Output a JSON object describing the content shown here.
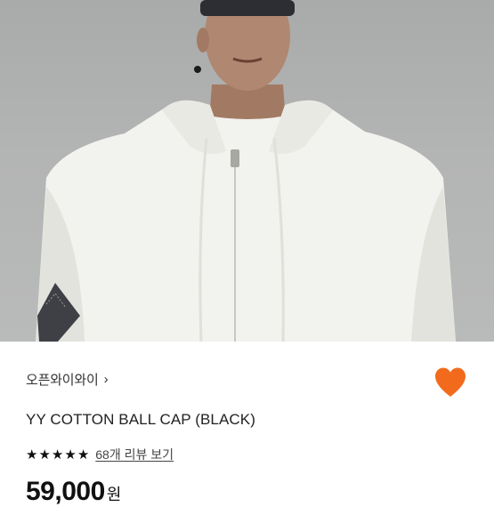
{
  "photo": {
    "alt_subject": "hoodie-model-photo"
  },
  "store": {
    "name": "오픈와이와이",
    "chevron": "›"
  },
  "product": {
    "title": "YY COTTON BALL CAP (BLACK)"
  },
  "rating": {
    "stars": 5,
    "star_glyph": "★",
    "review_text": "68개 리뷰 보기"
  },
  "price": {
    "amount": "59,000",
    "unit": "원"
  },
  "colors": {
    "heart": "#f26b1d",
    "text": "#222222"
  }
}
